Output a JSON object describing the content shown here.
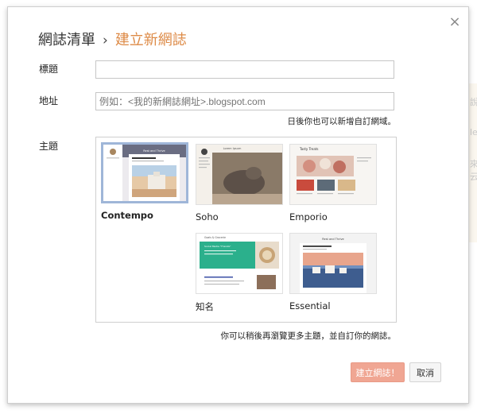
{
  "dialog": {
    "breadcrumb": {
      "parent": "網誌清單",
      "separator": "›",
      "current": "建立新網誌"
    },
    "close_icon": "×"
  },
  "form": {
    "title_label": "標題",
    "title_value": "",
    "address_label": "地址",
    "address_placeholder": "例如：<我的新網誌網址>.blogspot.com",
    "address_hint": "日後你也可以新增自訂網域。",
    "theme_label": "主題"
  },
  "themes": [
    {
      "name": "Contempo",
      "selected": true
    },
    {
      "name": "Soho",
      "selected": false
    },
    {
      "name": "Emporio",
      "selected": false
    },
    {
      "name": "知名",
      "selected": false
    },
    {
      "name": "Essential",
      "selected": false
    }
  ],
  "scrollbar": {
    "up_icon": "▲",
    "down_icon": "▼"
  },
  "thumb_text": {
    "contempo_header": "Rest and Thrive",
    "soho_header": "Lorem Ipsum",
    "emporio_header": "Tasty Treats",
    "notable_header": "Goals & Grocerie",
    "notable_post": "Social Media \"Friends\"",
    "essential_header": "Rest and Thrive"
  },
  "footer": {
    "hint": "你可以稍後再瀏覽更多主題，並自訂你的網誌。",
    "create_label": "建立網誌！",
    "cancel_label": "取消"
  },
  "colors": {
    "accent_breadcrumb": "#dd8a46",
    "create_button": "#f0a693",
    "selected_border": "#9fb6d8"
  }
}
